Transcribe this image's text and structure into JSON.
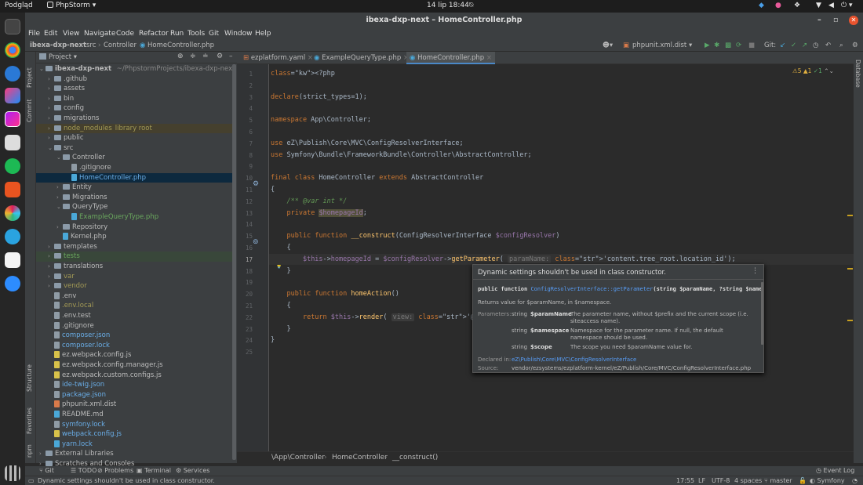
{
  "topbar": {
    "activities": "Podgląd",
    "app": "PhpStorm ▾",
    "datetime": "14 lip  18:44"
  },
  "window": {
    "title": "ibexa-dxp-next – HomeController.php"
  },
  "menu": [
    "File",
    "Edit",
    "View",
    "Navigate",
    "Code",
    "Refactor",
    "Run",
    "Tools",
    "Git",
    "Window",
    "Help"
  ],
  "nav": {
    "crumbs": [
      "ibexa-dxp-next",
      "src",
      "Controller",
      "HomeController.php"
    ],
    "run_config": "phpunit.xml.dist ▾",
    "git_label": "Git:"
  },
  "project": {
    "title": "Project ▾",
    "root_name": "ibexa-dxp-next",
    "root_path": "~/PhpstormProjects/ibexa-dxp-next",
    "items": [
      {
        "label": ".github",
        "kind": "folder",
        "depth": 1,
        "arrow": "›"
      },
      {
        "label": "assets",
        "kind": "folder",
        "depth": 1,
        "arrow": "›"
      },
      {
        "label": "bin",
        "kind": "folder",
        "depth": 1,
        "arrow": "›"
      },
      {
        "label": "config",
        "kind": "folder",
        "depth": 1,
        "arrow": "›"
      },
      {
        "label": "migrations",
        "kind": "folder",
        "depth": 1,
        "arrow": "›"
      },
      {
        "label": "node_modules",
        "kind": "folder",
        "depth": 1,
        "arrow": "›",
        "extra": "library root",
        "color": "#a39a55",
        "hl": "#45402e"
      },
      {
        "label": "public",
        "kind": "folder",
        "depth": 1,
        "arrow": "›"
      },
      {
        "label": "src",
        "kind": "folder",
        "depth": 1,
        "arrow": "⌄"
      },
      {
        "label": "Controller",
        "kind": "folder",
        "depth": 2,
        "arrow": "⌄"
      },
      {
        "label": ".gitignore",
        "kind": "file",
        "depth": 3,
        "arrow": "",
        "fc": "#8f9ba5"
      },
      {
        "label": "HomeController.php",
        "kind": "file",
        "depth": 3,
        "arrow": "",
        "fc": "#4aa8d8",
        "color": "#6aaee8",
        "sel": true
      },
      {
        "label": "Entity",
        "kind": "folder",
        "depth": 2,
        "arrow": "›"
      },
      {
        "label": "Migrations",
        "kind": "folder",
        "depth": 2,
        "arrow": "›"
      },
      {
        "label": "QueryType",
        "kind": "folder",
        "depth": 2,
        "arrow": "⌄"
      },
      {
        "label": "ExampleQueryType.php",
        "kind": "file",
        "depth": 3,
        "arrow": "",
        "fc": "#4aa8d8",
        "color": "#6aa85e"
      },
      {
        "label": "Repository",
        "kind": "folder",
        "depth": 2,
        "arrow": "›"
      },
      {
        "label": "Kernel.php",
        "kind": "file",
        "depth": 2,
        "arrow": "",
        "fc": "#4aa8d8"
      },
      {
        "label": "templates",
        "kind": "folder",
        "depth": 1,
        "arrow": "›"
      },
      {
        "label": "tests",
        "kind": "folder",
        "depth": 1,
        "arrow": "›",
        "color": "#6aa85e",
        "hl": "#39473a"
      },
      {
        "label": "translations",
        "kind": "folder",
        "depth": 1,
        "arrow": "›"
      },
      {
        "label": "var",
        "kind": "folder",
        "depth": 1,
        "arrow": "›",
        "color": "#a39a55"
      },
      {
        "label": "vendor",
        "kind": "folder",
        "depth": 1,
        "arrow": "›",
        "color": "#a39a55"
      },
      {
        "label": ".env",
        "kind": "file",
        "depth": 1,
        "arrow": "",
        "fc": "#8f9ba5"
      },
      {
        "label": ".env.local",
        "kind": "file",
        "depth": 1,
        "arrow": "",
        "fc": "#8f9ba5",
        "color": "#a39a55"
      },
      {
        "label": ".env.test",
        "kind": "file",
        "depth": 1,
        "arrow": "",
        "fc": "#8f9ba5"
      },
      {
        "label": ".gitignore",
        "kind": "file",
        "depth": 1,
        "arrow": "",
        "fc": "#8f9ba5"
      },
      {
        "label": "composer.json",
        "kind": "file",
        "depth": 1,
        "arrow": "",
        "fc": "#8f9ba5",
        "color": "#6aaee8"
      },
      {
        "label": "composer.lock",
        "kind": "file",
        "depth": 1,
        "arrow": "",
        "fc": "#8f9ba5",
        "color": "#6aaee8"
      },
      {
        "label": "ez.webpack.config.js",
        "kind": "file",
        "depth": 1,
        "arrow": "",
        "fc": "#d8c24a"
      },
      {
        "label": "ez.webpack.config.manager.js",
        "kind": "file",
        "depth": 1,
        "arrow": "",
        "fc": "#d8c24a"
      },
      {
        "label": "ez.webpack.custom.configs.js",
        "kind": "file",
        "depth": 1,
        "arrow": "",
        "fc": "#d8c24a"
      },
      {
        "label": "ide-twig.json",
        "kind": "file",
        "depth": 1,
        "arrow": "",
        "fc": "#8f9ba5",
        "color": "#6aaee8"
      },
      {
        "label": "package.json",
        "kind": "file",
        "depth": 1,
        "arrow": "",
        "fc": "#8f9ba5",
        "color": "#6aaee8"
      },
      {
        "label": "phpunit.xml.dist",
        "kind": "file",
        "depth": 1,
        "arrow": "",
        "fc": "#d87a4a"
      },
      {
        "label": "README.md",
        "kind": "file",
        "depth": 1,
        "arrow": "",
        "fc": "#4aa8d8"
      },
      {
        "label": "symfony.lock",
        "kind": "file",
        "depth": 1,
        "arrow": "",
        "fc": "#8f9ba5",
        "color": "#6aaee8"
      },
      {
        "label": "webpack.config.js",
        "kind": "file",
        "depth": 1,
        "arrow": "",
        "fc": "#d8c24a",
        "color": "#6aaee8"
      },
      {
        "label": "yarn.lock",
        "kind": "file",
        "depth": 1,
        "arrow": "",
        "fc": "#4aa8d8",
        "color": "#6aaee8"
      },
      {
        "label": "External Libraries",
        "kind": "folder",
        "depth": 0,
        "arrow": "›"
      },
      {
        "label": "Scratches and Consoles",
        "kind": "folder",
        "depth": 0,
        "arrow": "›"
      }
    ]
  },
  "tabs": [
    {
      "label": "ezplatform.yaml"
    },
    {
      "label": "ExampleQueryType.php"
    },
    {
      "label": "HomeController.php",
      "active": true
    }
  ],
  "inspections": {
    "warnings": "⚠5",
    "weak": "▲1",
    "ok": "✓1"
  },
  "code": [
    "<?php",
    "",
    "declare(strict_types=1);",
    "",
    "namespace App\\Controller;",
    "",
    "use eZ\\Publish\\Core\\MVC\\ConfigResolverInterface;",
    "use Symfony\\Bundle\\FrameworkBundle\\Controller\\AbstractController;",
    "",
    "final class HomeController extends AbstractController",
    "{",
    "    /** @var int */",
    "    private $homepageId;",
    "",
    "    public function __construct(ConfigResolverInterface $configResolver)",
    "    {",
    "        $this->homepageId = $configResolver->getParameter( paramName: 'content.tree_root.location_id');",
    "    }",
    "",
    "    public function homeAction()",
    "    {",
    "        return $this->render( view: '@ezdesign/home.",
    "    }",
    "}",
    ""
  ],
  "popup": {
    "title": "Dynamic settings shouldn't be used in class constructor.",
    "sig_prefix": "public function ",
    "sig_link": "ConfigResolverInterface::getParameter",
    "sig_rest": "(string $paramName, ?string $namespace",
    "desc": "Returns value for $paramName, in $namespace.",
    "params_label": "Parameters:",
    "params": [
      {
        "type": "string",
        "name": "$paramName",
        "desc": "The parameter name, without $prefix and the current scope (i.e. siteaccess name)."
      },
      {
        "type": "string",
        "name": "$namespace",
        "desc": "Namespace for the parameter name. If null, the default namespace should be used."
      },
      {
        "type": "string",
        "name": "$scope",
        "desc": "The scope you need $paramName value for."
      }
    ],
    "declared_label": "Declared in:",
    "declared_value": "eZ\\Publish\\Core\\MVC\\ConfigResolverInterface",
    "source_label": "Source:",
    "source_value": "vendor/ezsystems/ezplatform-kernel/eZ/Publish/Core/MVC/ConfigResolverInterface.php"
  },
  "breadcrumb": [
    "\\App\\Controller",
    "HomeController",
    "__construct()"
  ],
  "bottom_tools": [
    "Git",
    "TODO",
    "Problems",
    "Terminal",
    "Services"
  ],
  "event_log": "Event Log",
  "status": {
    "message": "Dynamic settings shouldn't be used in class constructor.",
    "position": "17:55",
    "line_sep": "LF",
    "encoding": "UTF-8",
    "indent": "4 spaces",
    "branch": "master",
    "framework": "Symfony"
  },
  "side_labels": {
    "project": "Project",
    "commit": "Commit",
    "structure": "Structure",
    "favorites": "Favorites",
    "npm": "npm",
    "database": "Database"
  },
  "colors": {
    "accent": "#4aa8d8",
    "selection": "#0d293e"
  }
}
